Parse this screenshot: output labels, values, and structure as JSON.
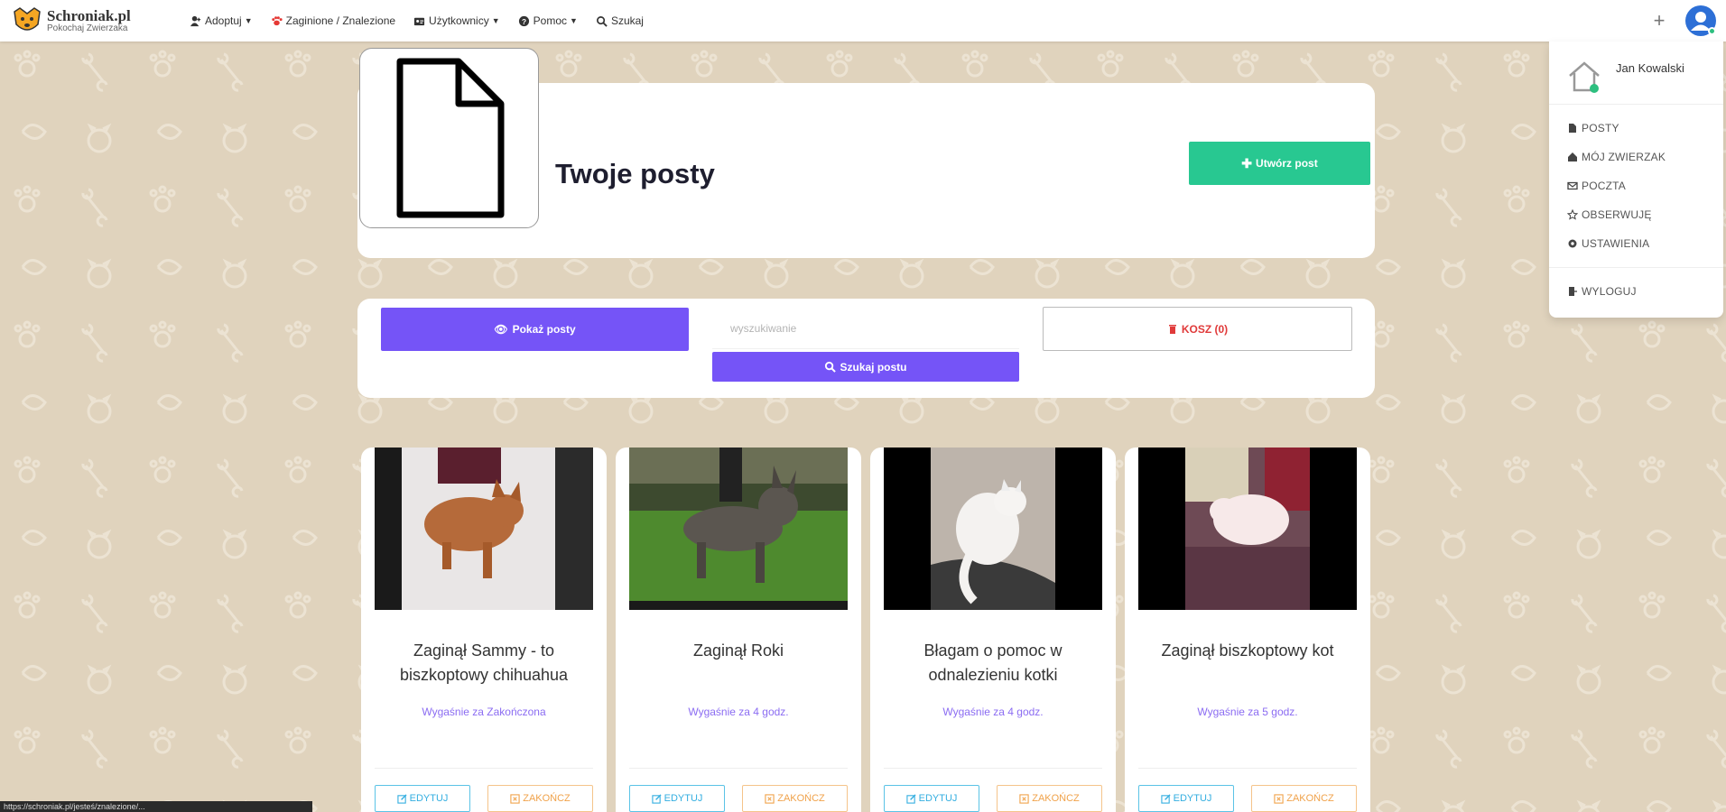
{
  "brand": {
    "name": "Schroniak.pl",
    "subtitle": "Pokochaj Zwierzaka"
  },
  "nav": {
    "items": [
      {
        "label": "Adoptuj",
        "icon": "person-plus-icon",
        "dropdown": true
      },
      {
        "label": "Zaginione / Znalezione",
        "icon": "paw-icon",
        "dropdown": false
      },
      {
        "label": "Użytkownicy",
        "icon": "id-card-icon",
        "dropdown": true
      },
      {
        "label": "Pomoc",
        "icon": "question-icon",
        "dropdown": true
      },
      {
        "label": "Szukaj",
        "icon": "search-icon",
        "dropdown": false
      }
    ],
    "plus_label": "+"
  },
  "user_menu": {
    "name": "Jan Kowalski",
    "items": [
      {
        "label": "POSTY",
        "icon": "file-icon"
      },
      {
        "label": "MÓJ ZWIERZAK",
        "icon": "home-icon"
      },
      {
        "label": "POCZTA",
        "icon": "envelope-icon"
      },
      {
        "label": "OBSERWUJĘ",
        "icon": "star-icon"
      },
      {
        "label": "USTAWIENIA",
        "icon": "gear-icon"
      }
    ],
    "logout_label": "WYLOGUJ"
  },
  "header": {
    "title": "Twoje posty",
    "create_label": "Utwórz post"
  },
  "controls": {
    "show_label": "Pokaż posty",
    "search_placeholder": "wyszukiwanie",
    "search_label": "Szukaj postu",
    "trash_label": "KOSZ (0)"
  },
  "posts": [
    {
      "title": "Zaginął Sammy - to biszkoptowy chihuahua",
      "expiry": "Wygaśnie za Zakończona",
      "edit_label": "EDYTUJ",
      "end_label": "ZAKOŃCZ"
    },
    {
      "title": "Zaginął Roki",
      "expiry": "Wygaśnie za 4 godz.",
      "edit_label": "EDYTUJ",
      "end_label": "ZAKOŃCZ"
    },
    {
      "title": "Błagam o pomoc w odnalezieniu kotki",
      "expiry": "Wygaśnie za 4 godz.",
      "edit_label": "EDYTUJ",
      "end_label": "ZAKOŃCZ"
    },
    {
      "title": "Zaginął biszkoptowy kot",
      "expiry": "Wygaśnie za 5 godz.",
      "edit_label": "EDYTUJ",
      "end_label": "ZAKOŃCZ"
    }
  ],
  "status_bar": {
    "url": "https://schroniak.pl/jesteś/znalezione/..."
  },
  "colors": {
    "accent_purple": "#7554f7",
    "accent_green": "#28c891",
    "background": "#e0d3bd",
    "edit_blue": "#33aee0",
    "end_orange": "#f0a24a",
    "trash_red": "#e03a3a"
  }
}
